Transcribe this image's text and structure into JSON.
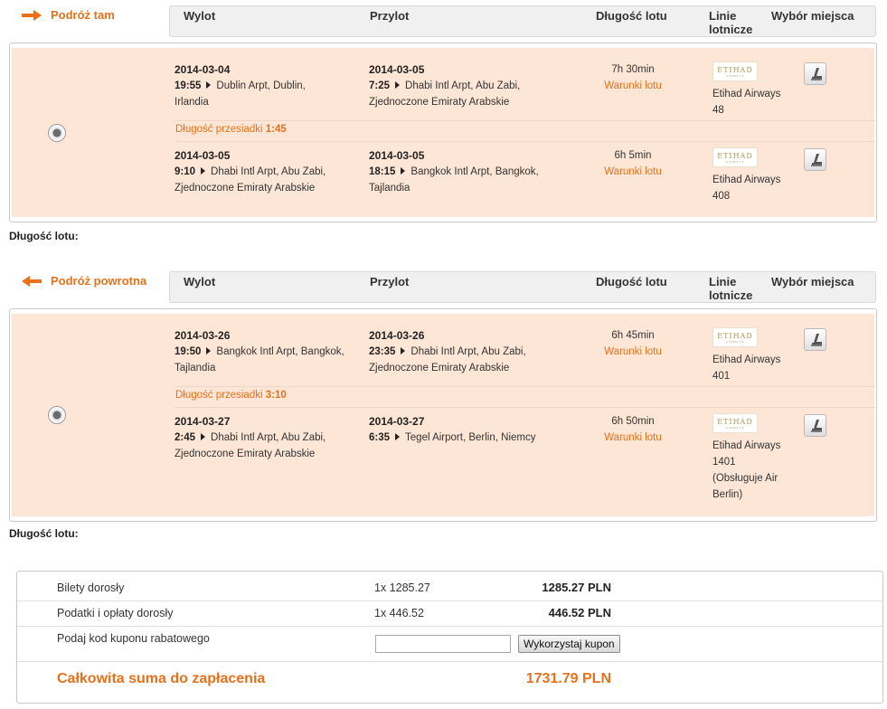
{
  "headers": {
    "departure": "Wylot",
    "arrival": "Przylot",
    "duration": "Długość lotu",
    "airlines": "Linie lotnicze",
    "seat_choice": "Wybór miejsca"
  },
  "outbound": {
    "title": "Podróż tam",
    "segments": [
      {
        "dep_date": "2014-03-04",
        "dep_time": "19:55",
        "dep_place": "Dublin Arpt, Dublin,",
        "dep_place2": "Irlandia",
        "arr_date": "2014-03-05",
        "arr_time": "7:25",
        "arr_place": "Dhabi Intl Arpt, Abu Zabi,",
        "arr_place2": "Zjednoczone Emiraty Arabskie",
        "duration": "7h 30min",
        "conditions": "Warunki lotu",
        "airline": "Etihad Airways",
        "flight": "48"
      },
      {
        "dep_date": "2014-03-05",
        "dep_time": "9:10",
        "dep_place": "Dhabi Intl Arpt, Abu Zabi,",
        "dep_place2": "Zjednoczone Emiraty Arabskie",
        "arr_date": "2014-03-05",
        "arr_time": "18:15",
        "arr_place": "Bangkok Intl Arpt, Bangkok,",
        "arr_place2": "Tajlandia",
        "duration": "6h 5min",
        "conditions": "Warunki lotu",
        "airline": "Etihad Airways",
        "flight": "408"
      }
    ],
    "layover_label": "Długość przesiadki",
    "layover_value": "1:45",
    "flight_length_label": "Długość lotu:"
  },
  "return": {
    "title": "Podróż powrotna",
    "segments": [
      {
        "dep_date": "2014-03-26",
        "dep_time": "19:50",
        "dep_place": "Bangkok Intl Arpt, Bangkok,",
        "dep_place2": "Tajlandia",
        "arr_date": "2014-03-26",
        "arr_time": "23:35",
        "arr_place": "Dhabi Intl Arpt, Abu Zabi,",
        "arr_place2": "Zjednoczone Emiraty Arabskie",
        "duration": "6h 45min",
        "conditions": "Warunki lotu",
        "airline": "Etihad Airways",
        "flight": "401"
      },
      {
        "dep_date": "2014-03-27",
        "dep_time": "2:45",
        "dep_place": "Dhabi Intl Arpt, Abu Zabi,",
        "dep_place2": "Zjednoczone Emiraty Arabskie",
        "arr_date": "2014-03-27",
        "arr_time": "6:35",
        "arr_place": "Tegel Airport, Berlin, Niemcy",
        "arr_place2": "",
        "duration": "6h 50min",
        "conditions": "Warunki lotu",
        "airline": "Etihad Airways",
        "flight": "1401",
        "operated_by": "(Obsługuje Air",
        "operated_by2": "Berlin)"
      }
    ],
    "layover_label": "Długość przesiadki",
    "layover_value": "3:10",
    "flight_length_label": "Długość lotu:"
  },
  "airline_logo_text": "ETIHAD",
  "summary": {
    "tickets_label": "Bilety dorosły",
    "tickets_qty": "1x 1285.27",
    "tickets_amount": "1285.27 PLN",
    "taxes_label": "Podatki i opłaty dorosły",
    "taxes_qty": "1x 446.52",
    "taxes_amount": "446.52 PLN",
    "coupon_label": "Podaj kod kuponu rabatowego",
    "coupon_value": "",
    "coupon_button": "Wykorzystaj kupon",
    "total_label": "Całkowita suma do zapłacenia",
    "total_amount": "1731.79 PLN"
  },
  "colors": {
    "accent": "#e8701a",
    "panel_bg": "#fde6d6",
    "header_bg": "#f0f0f0"
  },
  "icons": [
    "arrow-right-icon",
    "arrow-left-icon",
    "seat-icon",
    "etihad-logo"
  ]
}
